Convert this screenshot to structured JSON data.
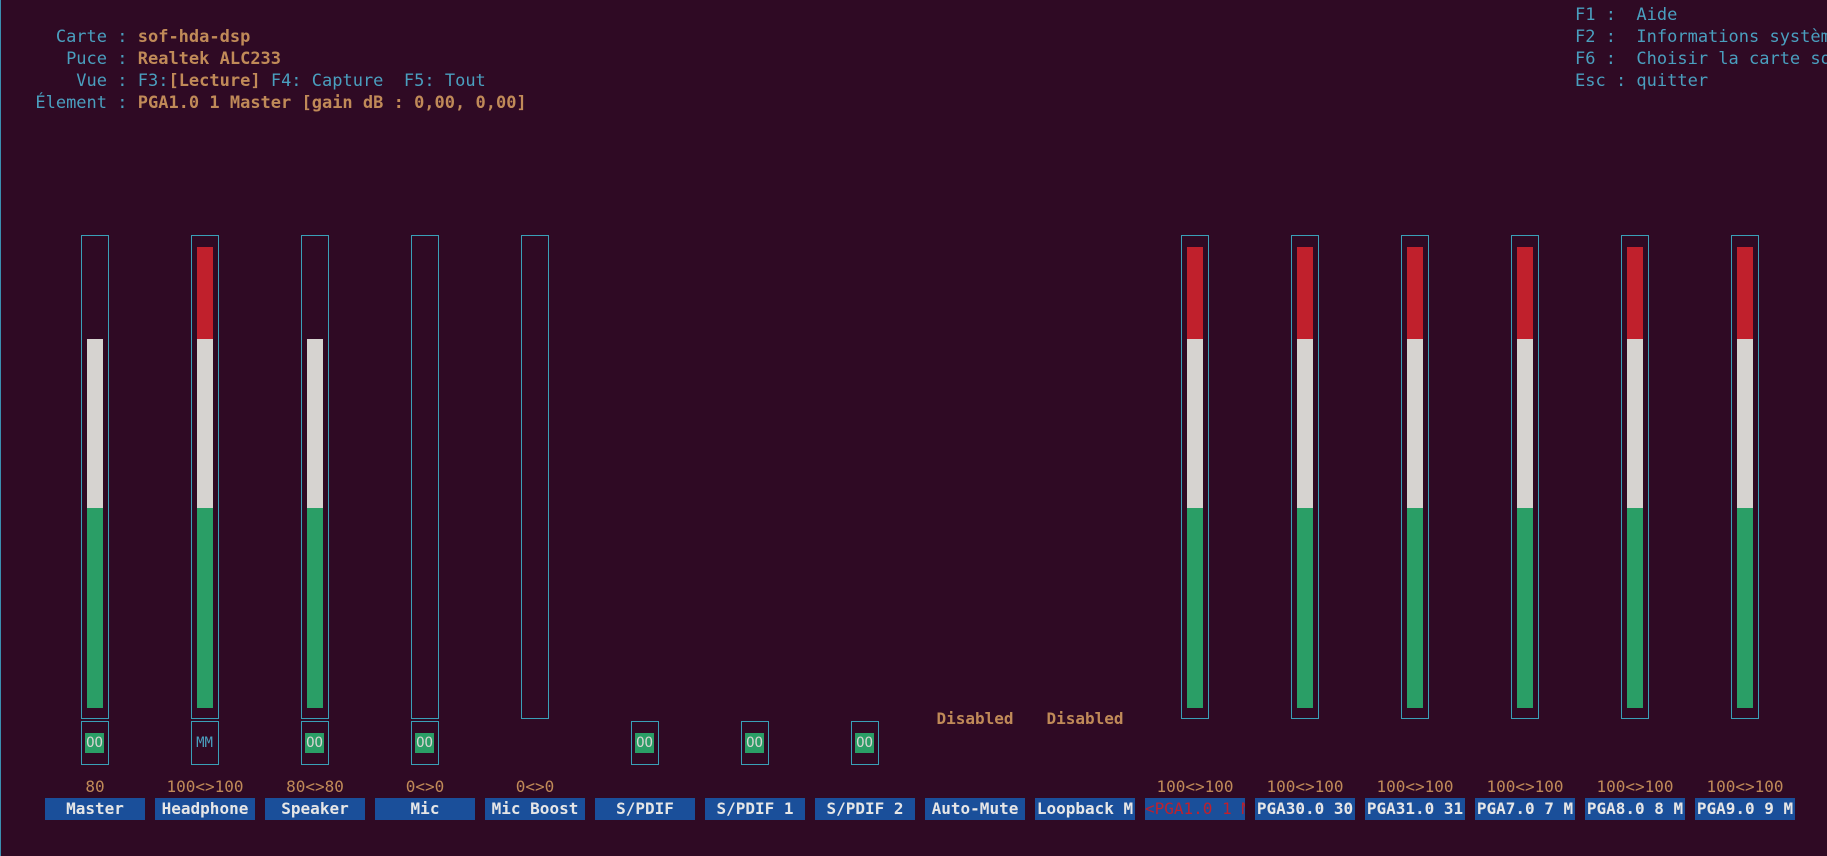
{
  "header": {
    "card_label": "Carte :",
    "card_value": "sof-hda-dsp",
    "chip_label": "Puce :",
    "chip_value": "Realtek ALC233",
    "view_label": "Vue :",
    "view_f3": "F3:",
    "view_f3_value": "[Lecture]",
    "view_f4": "F4: Capture",
    "view_f5": "F5: Tout",
    "element_label": "Élement :",
    "element_value": "PGA1.0 1 Master [gain dB : 0,00, 0,00]"
  },
  "help": {
    "f1": "F1 :  Aide",
    "f2": "F2 :  Informations systèm",
    "f6": "F6 :  Choisir la carte so",
    "esc": "Esc : quitter"
  },
  "controls": [
    {
      "name": "Master",
      "volume": "80",
      "level": 0.8,
      "switch": "OO",
      "has_meter": true
    },
    {
      "name": "Headphone",
      "volume": "100<>100",
      "level": 1.0,
      "switch": "MM",
      "has_meter": true
    },
    {
      "name": "Speaker",
      "volume": "80<>80",
      "level": 0.8,
      "switch": "OO",
      "has_meter": true
    },
    {
      "name": "Mic",
      "volume": "0<>0",
      "level": 0.0,
      "switch": "OO",
      "has_meter": true
    },
    {
      "name": "Mic Boost",
      "volume": "0<>0",
      "level": 0.0,
      "switch": "",
      "has_meter": true
    },
    {
      "name": "S/PDIF",
      "volume": "",
      "switch": "OO",
      "has_meter": false
    },
    {
      "name": "S/PDIF 1",
      "volume": "",
      "switch": "OO",
      "has_meter": false
    },
    {
      "name": "S/PDIF 2",
      "volume": "",
      "switch": "OO",
      "has_meter": false
    },
    {
      "name": "Auto-Mute",
      "volume": "",
      "status": "Disabled",
      "has_meter": false
    },
    {
      "name": "Loopback M",
      "volume": "",
      "status": "Disabled",
      "has_meter": false
    },
    {
      "name": "<PGA1.0 1 M>",
      "volume": "100<>100",
      "level": 1.0,
      "has_meter": true,
      "active": true
    },
    {
      "name": "PGA30.0 30",
      "volume": "100<>100",
      "level": 1.0,
      "has_meter": true
    },
    {
      "name": "PGA31.0 31",
      "volume": "100<>100",
      "level": 1.0,
      "has_meter": true
    },
    {
      "name": "PGA7.0 7 M",
      "volume": "100<>100",
      "level": 1.0,
      "has_meter": true
    },
    {
      "name": "PGA8.0 8 M",
      "volume": "100<>100",
      "level": 1.0,
      "has_meter": true
    },
    {
      "name": "PGA9.0 9 M",
      "volume": "100<>100",
      "level": 1.0,
      "has_meter": true
    }
  ],
  "colors": {
    "background": "#2f0a24",
    "meter_red": "#c0202c",
    "meter_white": "#d6d3d0",
    "meter_green": "#2a9e66",
    "label_bg": "#1a4f9a",
    "value_orange": "#c08a58"
  }
}
